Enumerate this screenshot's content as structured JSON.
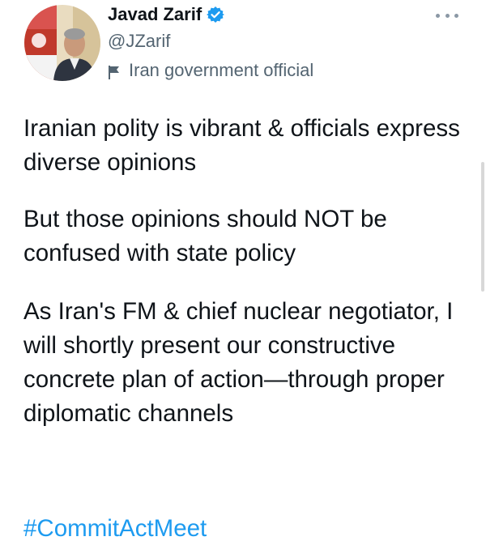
{
  "author": {
    "display_name": "Javad Zarif",
    "handle": "@JZarif",
    "label": "Iran government official",
    "verified": true
  },
  "tweet": {
    "paragraphs": [
      "Iranian polity is vibrant & officials express diverse opinions",
      "But those opinions should NOT be confused with state policy",
      "As Iran's FM & chief nuclear negotiator, I will shortly present our constructive concrete plan of action—through proper diplomatic channels"
    ],
    "hashtag": "#CommitActMeet"
  },
  "icons": {
    "verified": "verified-badge-icon",
    "label": "flag-icon",
    "more": "more-options-icon"
  },
  "colors": {
    "text": "#0f1419",
    "secondary": "#536471",
    "link": "#1d9bf0",
    "verified": "#1d9bf0"
  }
}
